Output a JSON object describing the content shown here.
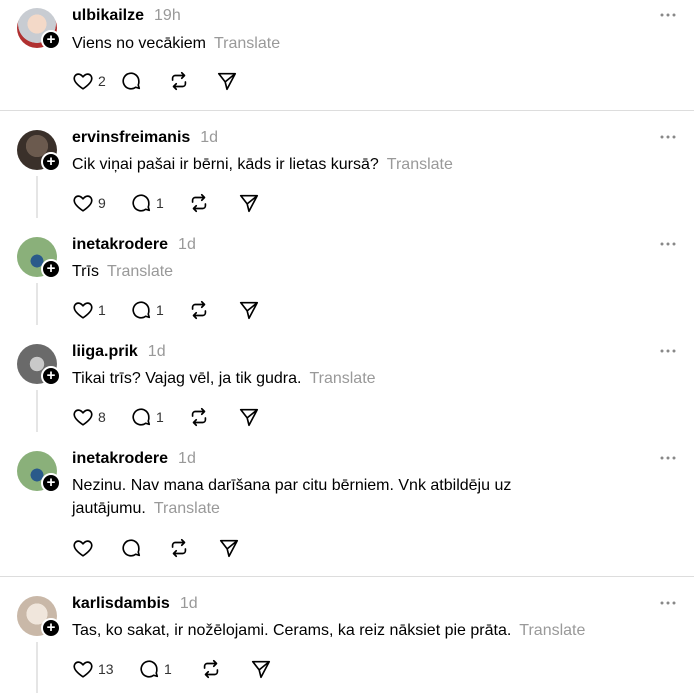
{
  "posts": [
    {
      "username": "ulbikailze",
      "time": "19h",
      "text": "Viens no vecākiem",
      "translate": "Translate",
      "likes": "2",
      "replies": "",
      "avatar_color": "#b8c0c8"
    },
    {
      "username": "ervinsfreimanis",
      "time": "1d",
      "text": "Cik viņai pašai ir bērni, kāds ir lietas kursā?",
      "translate": "Translate",
      "likes": "9",
      "replies": "1",
      "avatar_color": "#5a4a42"
    },
    {
      "username": "inetakrodere",
      "time": "1d",
      "text": "Trīs",
      "translate": "Translate",
      "likes": "1",
      "replies": "1",
      "avatar_color": "#7a9a6a"
    },
    {
      "username": "liiga.prik",
      "time": "1d",
      "text": "Tikai trīs? Vajag vēl, ja tik gudra.",
      "translate": "Translate",
      "likes": "8",
      "replies": "1",
      "avatar_color": "#8a8a8a"
    },
    {
      "username": "inetakrodere",
      "time": "1d",
      "text_line1": "Nezinu. Nav mana darīšana par citu bērniem. Vnk atbildēju uz",
      "text_line2": "jautājumu.",
      "translate": "Translate",
      "likes": "",
      "replies": "",
      "avatar_color": "#7a9a6a"
    },
    {
      "username": "karlisdambis",
      "time": "1d",
      "text": "Tas, ko sakat, ir nožēlojami. Cerams, ka reiz nāksiet pie prāta.",
      "translate": "Translate",
      "likes": "13",
      "replies": "1",
      "avatar_color": "#d9cfc6"
    }
  ]
}
